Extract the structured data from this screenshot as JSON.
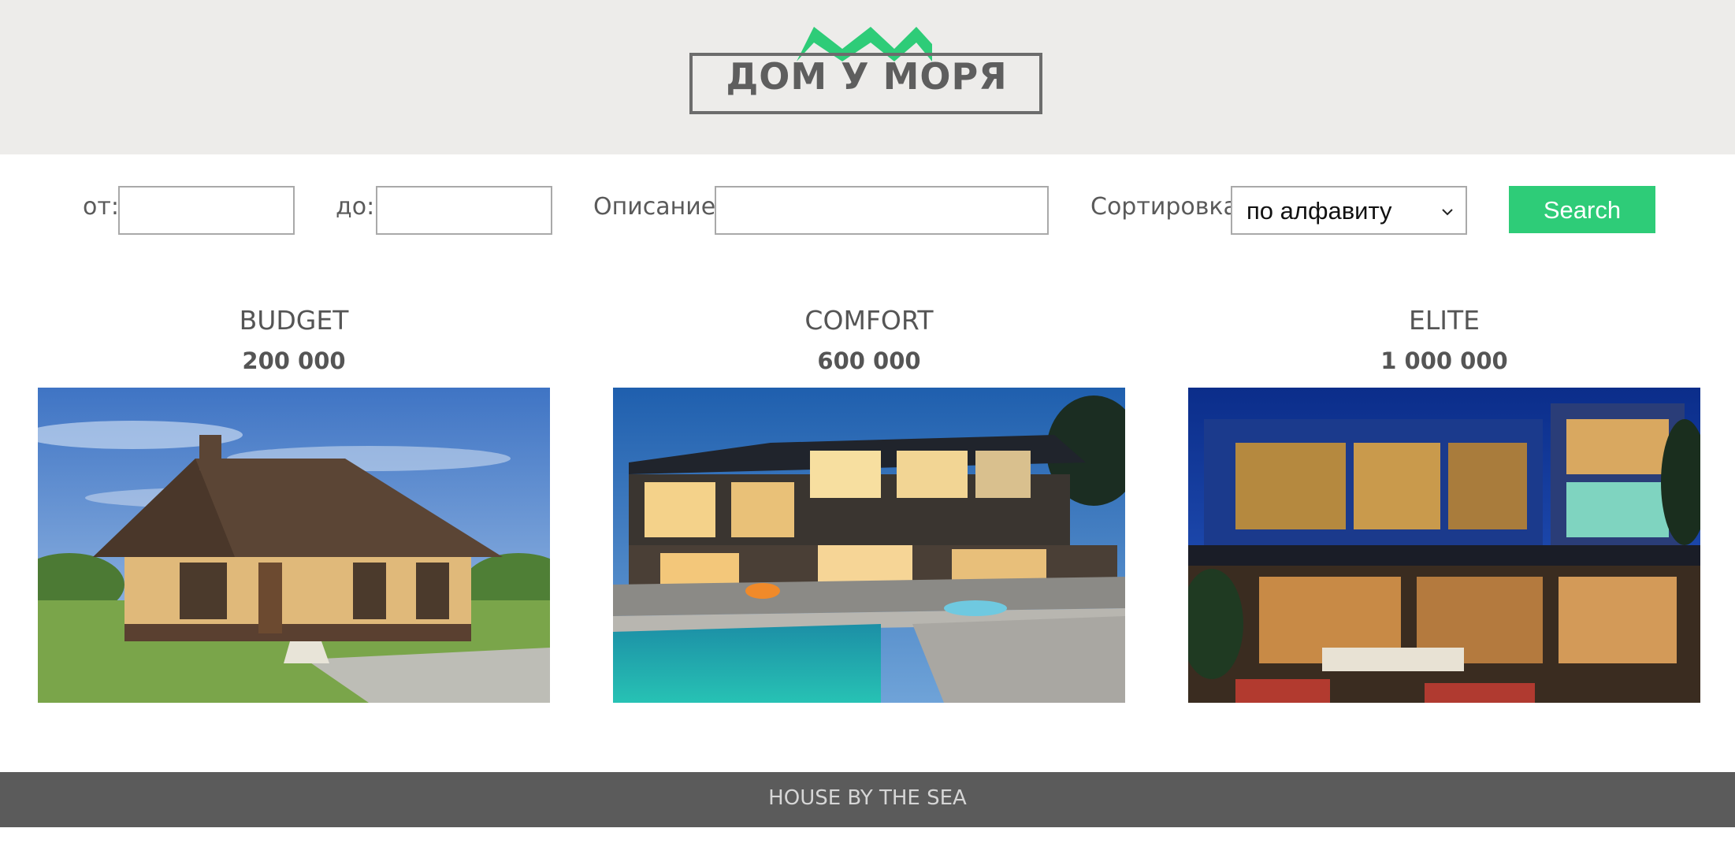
{
  "header": {
    "logo_text": "ДОМ У МОРЯ",
    "logo_accent_color": "#2ecc78",
    "logo_frame_color": "#6c6c6c"
  },
  "filters": {
    "from_label": "от:",
    "from_value": "",
    "to_label": "до:",
    "to_value": "",
    "description_label": "Описание:",
    "description_value": "",
    "sort_label": "Сортировка:",
    "sort_selected": "по алфавиту",
    "search_button_label": "Search",
    "accent_color": "#2ecc78"
  },
  "cards": [
    {
      "title": "BUDGET",
      "price": "200 000"
    },
    {
      "title": "COMFORT",
      "price": "600 000"
    },
    {
      "title": "ELITE",
      "price": "1 000 000"
    }
  ],
  "footer": {
    "text": "HOUSE BY THE SEA"
  }
}
